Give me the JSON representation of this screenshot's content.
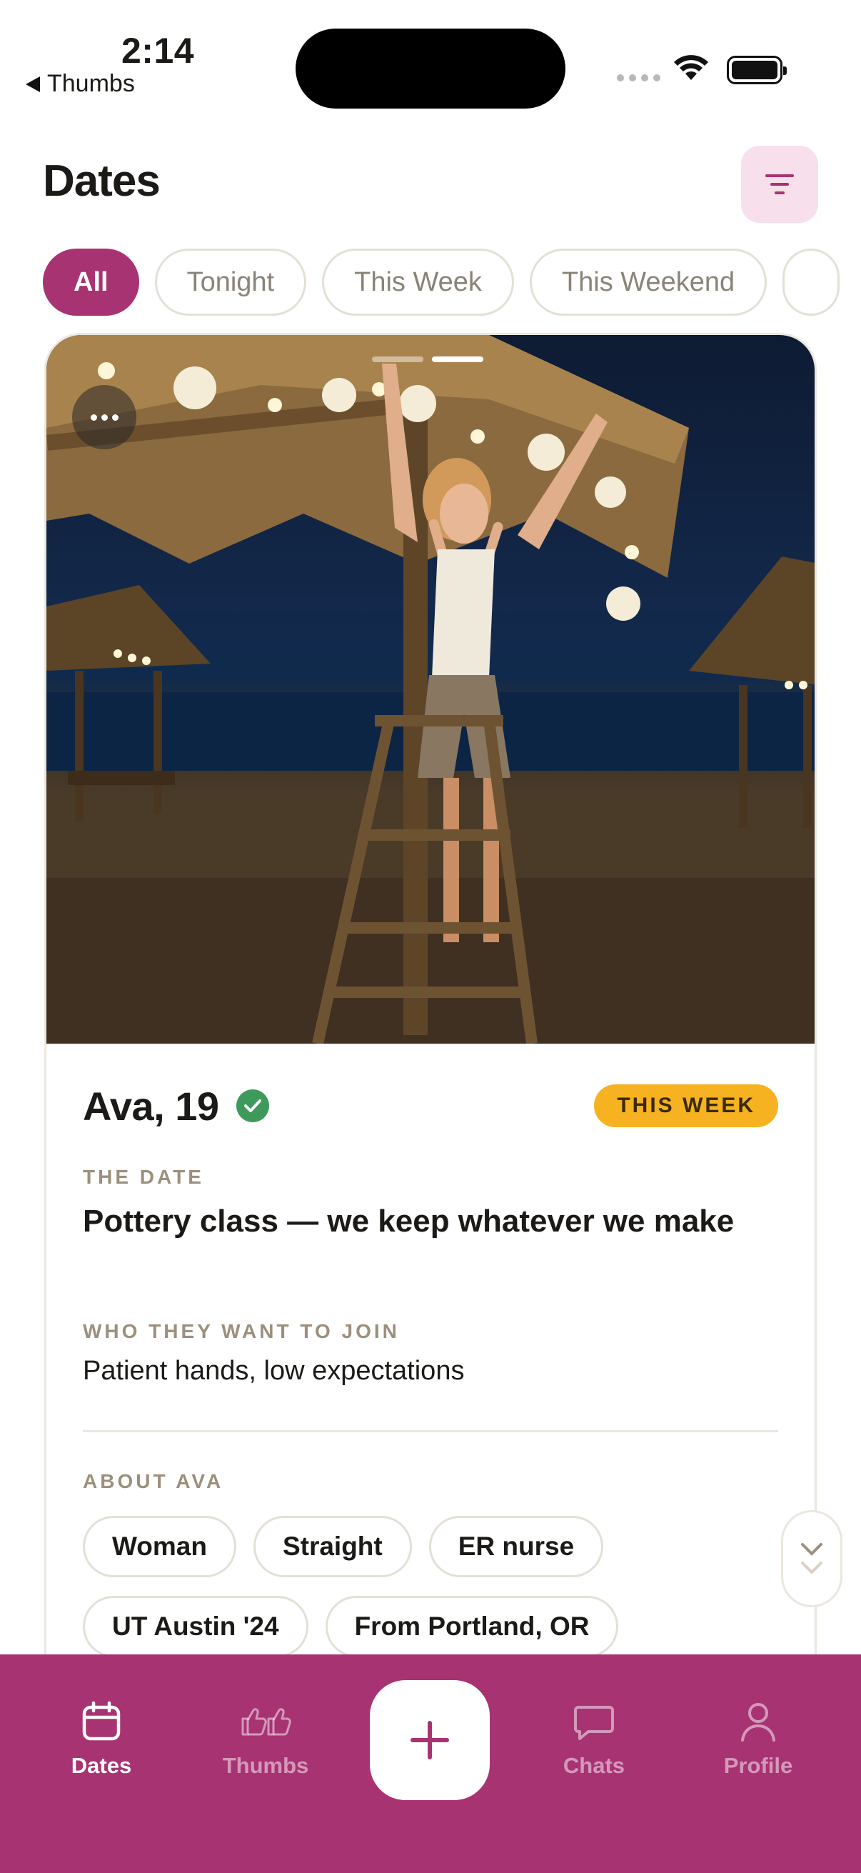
{
  "status_bar": {
    "time": "2:14",
    "back_app": "Thumbs"
  },
  "header": {
    "title": "Dates"
  },
  "filters": [
    {
      "label": "All",
      "active": true
    },
    {
      "label": "Tonight",
      "active": false
    },
    {
      "label": "This Week",
      "active": false
    },
    {
      "label": "This Weekend",
      "active": false
    }
  ],
  "card": {
    "photo_count": 2,
    "photo_index": 2,
    "name_age": "Ava, 19",
    "verified": true,
    "timing_badge": "THIS WEEK",
    "date_label": "THE DATE",
    "date_title": "Pottery class — we keep whatever we make",
    "join_label": "WHO THEY WANT TO JOIN",
    "join_text": "Patient hands, low expectations",
    "about_label": "ABOUT AVA",
    "tags": [
      "Woman",
      "Straight",
      "ER nurse",
      "UT Austin '24",
      "From Portland, OR"
    ]
  },
  "tabbar": {
    "tabs": [
      {
        "label": "Dates",
        "icon": "calendar-icon",
        "active": true
      },
      {
        "label": "Thumbs",
        "icon": "thumbs-up-icon",
        "active": false
      },
      {
        "label": "Chats",
        "icon": "chat-bubble-icon",
        "active": false
      },
      {
        "label": "Profile",
        "icon": "person-icon",
        "active": false
      }
    ],
    "fab_icon": "plus-icon"
  },
  "colors": {
    "brand": "#a83372",
    "badge": "#f6b221",
    "verified": "#3e9a5b",
    "filter_bg": "#f7dfeb"
  }
}
